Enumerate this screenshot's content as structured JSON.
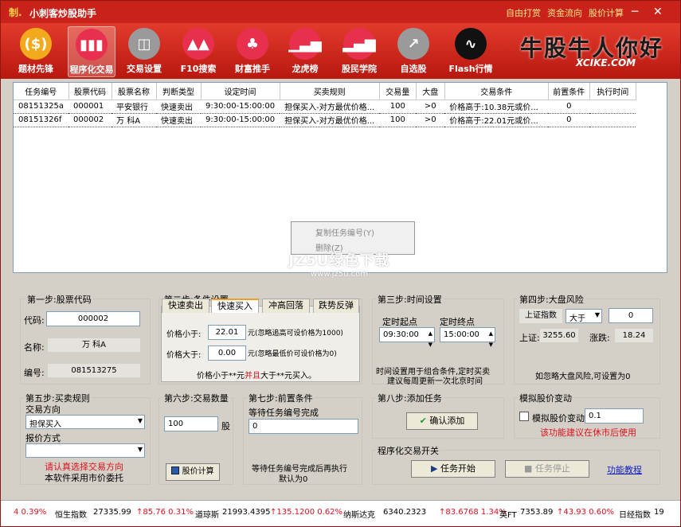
{
  "title": {
    "logo": "制.",
    "app": "小刺客炒股助手",
    "menu": [
      "自由打赏",
      "资金流向",
      "股价计算"
    ],
    "controls": [
      "─",
      "✕"
    ]
  },
  "toolbar": [
    {
      "label": "题材先锋",
      "color": "#f2a91c",
      "icon": "($)"
    },
    {
      "label": "程序化交易",
      "color": "#e8304e",
      "icon": "▮▮▮",
      "active": true
    },
    {
      "label": "交易设置",
      "color": "#9a9a9a",
      "icon": "◫"
    },
    {
      "label": "F10搜索",
      "color": "#e8304e",
      "icon": "▲▲"
    },
    {
      "label": "财富推手",
      "color": "#e8304e",
      "icon": "♣"
    },
    {
      "label": "龙虎榜",
      "color": "#e8304e",
      "icon": "▁▃▅"
    },
    {
      "label": "股民学院",
      "color": "#e8304e",
      "icon": "▂▄▆"
    },
    {
      "label": "自选股",
      "color": "#9a9a9a",
      "icon": "↗"
    },
    {
      "label": "Flash行情",
      "color": "#111",
      "icon": "∿"
    }
  ],
  "brand": {
    "main": "牛股牛人你好",
    "sub": "XCIKE.COM"
  },
  "grid": {
    "headers": [
      "任务编号",
      "股票代码",
      "股票名称",
      "判断类型",
      "设定时间",
      "买卖规则",
      "交易量",
      "大盘",
      "交易条件",
      "前置条件",
      "执行时间"
    ],
    "rows": [
      [
        "08151325a",
        "000001",
        "平安银行",
        "快速卖出",
        "9:30:00-15:00:00",
        "担保买入-对方最优价格...",
        "100",
        ">0",
        "价格高于:10.38元或价...",
        "0",
        ""
      ],
      [
        "08151326f",
        "000002",
        "万 科A",
        "快速卖出",
        "9:30:00-15:00:00",
        "担保买入-对方最优价格...",
        "100",
        ">0",
        "价格高于:22.01元或价...",
        "0",
        ""
      ]
    ]
  },
  "context_menu": [
    "复制任务编号(Y)",
    "删除(Z)"
  ],
  "watermark": {
    "line1": "JZ5U绿色下载",
    "line2": "www.jz5u.com"
  },
  "step1": {
    "title": "第一步:股票代码",
    "code_label": "代码:",
    "code": "000002",
    "name_label": "名称:",
    "name": "万 科A",
    "id_label": "编号:",
    "id": "081513275"
  },
  "step2": {
    "title": "第二步:条件设置",
    "tabs": [
      "快速卖出",
      "快速买入",
      "冲高回落",
      "跌势反弹"
    ],
    "lt_label": "价格小于:",
    "lt": "22.01",
    "lt_note": "元(忽略追高可设价格为1000)",
    "gt_label": "价格大于:",
    "gt": "0.00",
    "gt_note": "元(忽略最低价可设价格为0)",
    "hint_a": "价格小于**元",
    "hint_b": "并且",
    "hint_c": "大于**元买入。"
  },
  "step3": {
    "title": "第三步:时间设置",
    "start_label": "定时起点",
    "start": "09:30:00",
    "end_label": "定时终点",
    "end": "15:00:00",
    "note1": "时间设置用于组合条件,定时买卖",
    "note2": "建议每周更新一次北京时间"
  },
  "step4": {
    "title": "第四步:大盘风险",
    "index": "上证指数",
    "op": "大于",
    "value": "0",
    "price_label": "上证:",
    "price": "3255.60",
    "chg_label": "涨跌:",
    "chg": "18.24",
    "note": "如忽略大盘风险,可设置为0"
  },
  "step5": {
    "title": "第五步:买卖规则",
    "dir_label": "交易方向",
    "dir": "担保买入",
    "quote_label": "报价方式",
    "quote": "",
    "warn": "请认真选择交易方向",
    "note": "本软件采用市价委托"
  },
  "step6": {
    "title": "第六步:交易数量",
    "qty": "100",
    "unit": "股",
    "calc": "股价计算"
  },
  "step7": {
    "title": "第七步:前置条件",
    "label": "等待任务编号完成",
    "value": "0",
    "note1": "等待任务编号完成后再执行",
    "note2": "默认为0"
  },
  "step8": {
    "title": "第八步:添加任务",
    "confirm": "确认添加"
  },
  "sim": {
    "title": "模拟股价变动",
    "check": "模拟股价变动",
    "value": "0.1",
    "note": "该功能建议在休市后使用"
  },
  "prog": {
    "title": "程序化交易开关",
    "start": "任务开始",
    "stop": "任务停止",
    "help": "功能教程"
  },
  "ticker": [
    "4 0.39%",
    "恒生指数",
    "27335.99",
    "↑85.76 0.31%",
    "道琼斯",
    "21993.4395",
    "↑135.1200 0.62%",
    "纳斯达克",
    "6340.2323",
    "↑83.6768 1.34%",
    "英FT",
    "7353.89",
    "↑43.93 0.60%",
    "日经指数",
    "19"
  ],
  "colors": {
    "title_red": "#c8221a",
    "accent_red": "#e0101a",
    "up_red": "#e0101a"
  }
}
